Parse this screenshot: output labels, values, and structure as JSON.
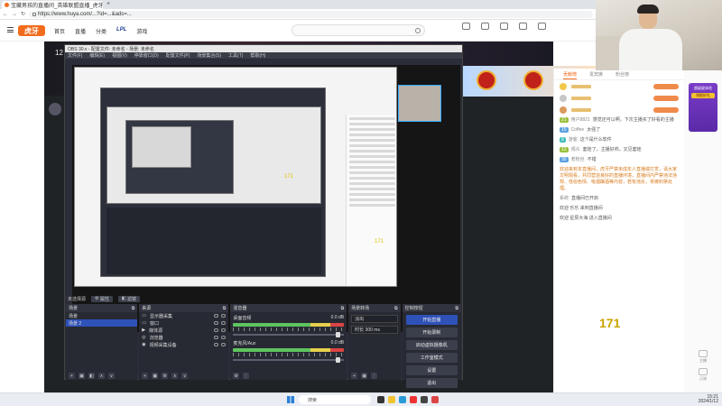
{
  "browser": {
    "tab_title": "宝藏男孩的直播间_英雄联盟直播_虎牙直播",
    "new_tab": "+",
    "url": "https://www.huya.com/...?id=...&ads=..."
  },
  "site": {
    "logo": "虎牙",
    "nav": [
      "首页",
      "直播",
      "分类",
      "LPL",
      "游戏"
    ]
  },
  "stream": {
    "room_number": "12"
  },
  "obs": {
    "window_title": "OBS 30.x - 配置文件: 未命名 - 场景: 未命名",
    "menu": [
      "文件(F)",
      "编辑(E)",
      "视图(V)",
      "停靠窗口(D)",
      "配置文件(P)",
      "场景集合(S)",
      "工具(T)",
      "帮助(H)"
    ],
    "status_label": "未选择源",
    "properties_btn": "属性",
    "filters_btn": "滤镜",
    "docks": {
      "scenes": {
        "title": "场景",
        "items": [
          "场景",
          "场景 2"
        ],
        "selected_index": 1
      },
      "sources": {
        "title": "来源",
        "items": [
          "显示器采集",
          "窗口",
          "媒体源",
          "浏览器",
          "视频采集设备"
        ]
      },
      "mixer": {
        "title": "混音器",
        "channels": [
          {
            "name": "桌面音频",
            "db": "0.0 dB"
          },
          {
            "name": "麦克风/Aux",
            "db": "0.0 dB"
          }
        ]
      },
      "transitions": {
        "title": "场景转场",
        "type": "淡出",
        "duration_label": "时长",
        "duration": "300 ms"
      },
      "controls": {
        "title": "控制按钮",
        "buttons": [
          "开始直播",
          "开始录制",
          "启动虚拟摄像机",
          "工作室模式",
          "设置",
          "退出"
        ]
      }
    },
    "footer_icons": [
      "+",
      "−",
      "⚙",
      "∧",
      "∨"
    ]
  },
  "inner_numbers": {
    "preview_number": "171",
    "chat_number": "171"
  },
  "chat": {
    "tabs": [
      "贡献榜",
      "贵宾席",
      "粉丝榜"
    ],
    "ranks": [
      "1",
      "2",
      "3"
    ],
    "messages": [
      {
        "level": "21",
        "nick": "用户8821",
        "text": "感觉还可以啊，下次主播买了好看的主播",
        "style": "normal"
      },
      {
        "level": "15",
        "nick": "Coffee",
        "text": "太强了",
        "style": "normal"
      },
      {
        "level": "9",
        "nick": "游客",
        "text": "这个是什么软件",
        "style": "normal"
      },
      {
        "level": "12",
        "nick": "观众",
        "text": "套娃了，主播好帅，又见套娃",
        "style": "normal"
      },
      {
        "level": "30",
        "nick": "老粉丝",
        "text": "不错",
        "style": "normal"
      },
      {
        "level": "",
        "nick": "",
        "text": "欢迎来到本直播间，虎牙严禁未成年人直播或打赏，请大家文明观看，共同营造良好的直播环境，直播间内严禁违法违规、低俗色情、吸烟酗酒等内容，若有违反，将被封禁处理。",
        "style": "orange"
      },
      {
        "level": "",
        "nick": "系统",
        "text": "直播间已开启",
        "style": "normal"
      },
      {
        "level": "",
        "nick": "",
        "text": "欢迎 乐乐 来到直播间",
        "style": "normal"
      },
      {
        "level": "",
        "nick": "",
        "text": "欢迎 星辰大海 进入直播间",
        "style": "normal"
      }
    ]
  },
  "rail": {
    "card_title": "超级星体验",
    "card_highlight": "领取好礼",
    "items": [
      "主播",
      "订阅"
    ]
  },
  "taskbar": {
    "search_placeholder": "搜索",
    "time": "15:21",
    "date": "2024/1/12"
  },
  "colors": {
    "brand": "#f36b1c",
    "obs_bg": "#2b2e38",
    "obs_selected": "#2f52b8",
    "number_yellow": "#c9a400"
  }
}
